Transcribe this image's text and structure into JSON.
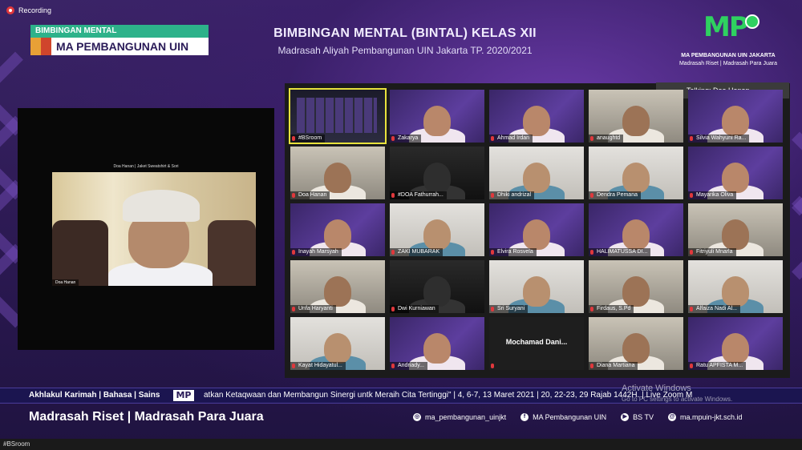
{
  "recording": {
    "label": "Recording"
  },
  "badge": {
    "top": "BIMBINGAN MENTAL",
    "main": "MA PEMBANGUNAN UIN"
  },
  "header": {
    "title": "BIMBINGAN MENTAL (BINTAL) KELAS XII",
    "subtitle": "Madrasah Aliyah Pembangunan UIN Jakarta TP. 2020/2021"
  },
  "logo": {
    "text": "MP",
    "color": "#2fd160"
  },
  "school": {
    "line1": "MA PEMBANGUNAN UIN JAKARTA",
    "line2": "Madrasah Riset | Madrasah Para Juara"
  },
  "zoom": {
    "talking": "Talking: Doa Hanan",
    "big_caption": "Doa Hanan | Jaket Sweatshirt & Sori",
    "big_name": "Doa Hanan",
    "participants": [
      {
        "name": "#BSroom",
        "style": "screen"
      },
      {
        "name": "Zakarya",
        "style": "purple"
      },
      {
        "name": "Ahmad Irdan",
        "style": "purple"
      },
      {
        "name": "anaughtd",
        "style": "room"
      },
      {
        "name": "Silvia Wahyuni Ra...",
        "style": "purple"
      },
      {
        "name": "Doa Hanan",
        "style": "room"
      },
      {
        "name": "#DOA Fathurrah...",
        "style": "dark"
      },
      {
        "name": "Dhiki andrizal",
        "style": "light"
      },
      {
        "name": "Dendra Pemana",
        "style": "light"
      },
      {
        "name": "Mayarika Oliva",
        "style": "purple"
      },
      {
        "name": "Inayah Marsyah",
        "style": "purple"
      },
      {
        "name": "ZAKI MUBARAK",
        "style": "light"
      },
      {
        "name": "Elvira Rosvela",
        "style": "purple"
      },
      {
        "name": "HALIMATUSSA DI...",
        "style": "purple"
      },
      {
        "name": "Fitriyuli Mnarla",
        "style": "room"
      },
      {
        "name": "Unfa Haryanti",
        "style": "room"
      },
      {
        "name": "Dwi Kurniawan",
        "style": "dark"
      },
      {
        "name": "Sri Suryani",
        "style": "light"
      },
      {
        "name": "Firdaus, S.Pd",
        "style": "room"
      },
      {
        "name": "Alfaiza Nadi Al...",
        "style": "light"
      },
      {
        "name": "Kayat Hidayatul...",
        "style": "light"
      },
      {
        "name": "Andriady...",
        "style": "purple"
      },
      {
        "name": "Mochamad Dani...",
        "style": "text"
      },
      {
        "name": "Diana Martiana",
        "style": "room"
      },
      {
        "name": "Ratu APFISTA M...",
        "style": "purple"
      }
    ]
  },
  "ticker": {
    "left": "Akhlakul Karimah | Bahasa | Sains",
    "logo": "MP",
    "text": "atkan Ketaqwaan dan Membangun Sinergi untk Meraih Cita Tertinggi\" | 4, 6-7, 13 Maret 2021 | 20, 22-23, 29 Rajab 1442H. | Live Zoom M"
  },
  "footer": {
    "left": "Madrasah Riset | Madrasah Para Juara",
    "instagram": "ma_pembangunan_uinjkt",
    "facebook": "MA Pembangunan UIN",
    "tv": "BS TV",
    "web": "ma.mpuin-jkt.sch.id"
  },
  "watermark": {
    "line1": "Activate Windows",
    "line2": "Go to PC settings to activate Windows."
  },
  "taskbar": {
    "label": "#BSroom"
  }
}
